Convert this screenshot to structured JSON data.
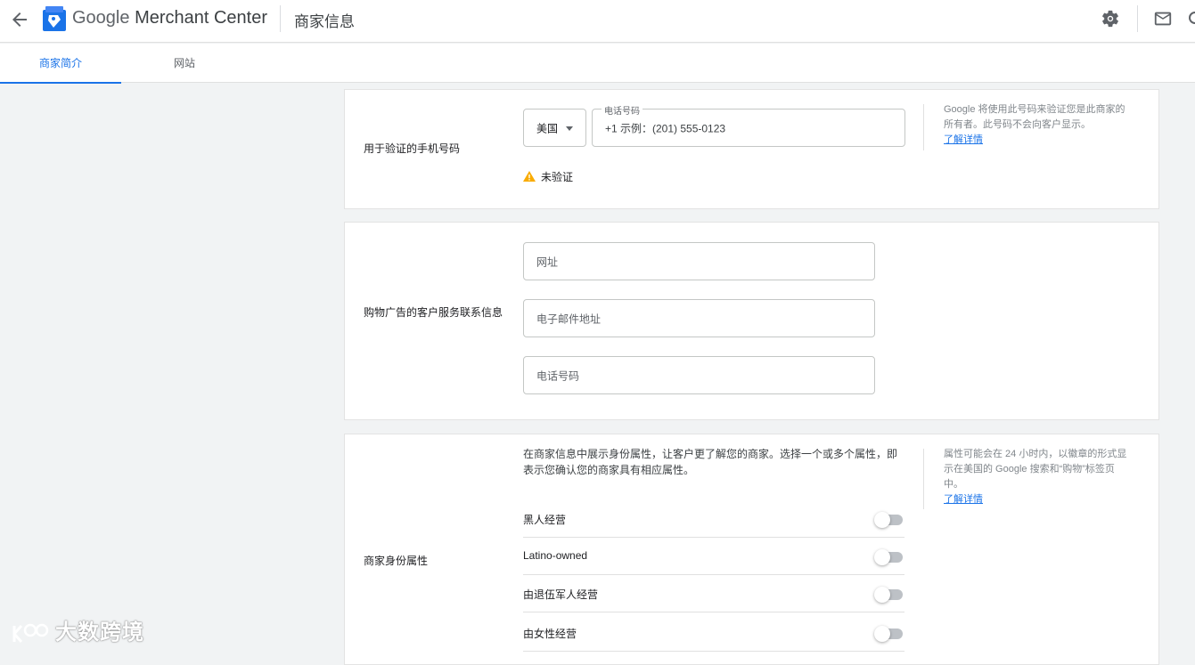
{
  "header": {
    "brand_google": "Google",
    "brand_product": "Merchant Center",
    "page_title": "商家信息",
    "icons": [
      "back-arrow-icon",
      "merchant-center-logo-icon",
      "gear-icon",
      "mail-icon"
    ]
  },
  "tabs": [
    {
      "label": "商家简介",
      "active": true
    },
    {
      "label": "网站",
      "active": false
    }
  ],
  "phone_section": {
    "label": "用于验证的手机号码",
    "country": "美国",
    "phone_field_label": "电话号码",
    "phone_placeholder": "+1 示例：(201) 555-0123",
    "status": "未验证",
    "helper": "Google 将使用此号码来验证您是此商家的所有者。此号码不会向客户显示。",
    "helper_link": "了解详情"
  },
  "contact_section": {
    "label": "购物广告的客户服务联系信息",
    "website_placeholder": "网址",
    "email_placeholder": "电子邮件地址",
    "phone_placeholder": "电话号码"
  },
  "identity_section": {
    "label": "商家身份属性",
    "description": "在商家信息中展示身份属性，让客户更了解您的商家。选择一个或多个属性，即表示您确认您的商家具有相应属性。",
    "helper": "属性可能会在 24 小时内，以徽章的形式显示在美国的 Google 搜索和“购物”标签页中。",
    "helper_link": "了解详情",
    "attributes": [
      {
        "label": "黑人经营",
        "enabled": false
      },
      {
        "label": "Latino-owned",
        "enabled": false
      },
      {
        "label": "由退伍军人经营",
        "enabled": false
      },
      {
        "label": "由女性经营",
        "enabled": false
      }
    ]
  },
  "watermark": "大数跨境",
  "colors": {
    "accent": "#1a73e8",
    "warning": "#f9ab00",
    "background": "#f1f3f4"
  }
}
